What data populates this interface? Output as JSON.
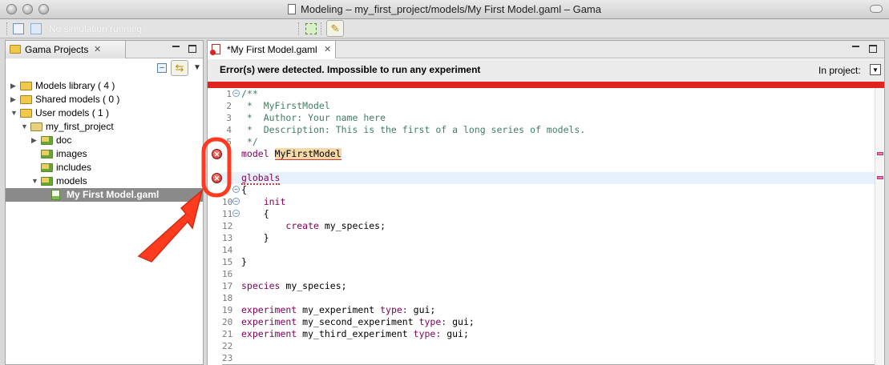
{
  "window": {
    "title": "Modeling – my_first_project/models/My First Model.gaml – Gama"
  },
  "toolbar": {
    "simulation_status": "No simulation running"
  },
  "projects_view": {
    "title": "Gama Projects",
    "close_glyph": "✕",
    "tree": [
      {
        "label": "Models library ( 4 )",
        "depth": 0,
        "expanded": false,
        "icon": "folder-icon"
      },
      {
        "label": "Shared models ( 0 )",
        "depth": 0,
        "expanded": false,
        "icon": "folder-icon"
      },
      {
        "label": "User models ( 1 )",
        "depth": 0,
        "expanded": true,
        "icon": "folder-icon"
      },
      {
        "label": "my_first_project",
        "depth": 1,
        "expanded": true,
        "icon": "project-icon"
      },
      {
        "label": "doc",
        "depth": 2,
        "expanded": false,
        "icon": "folder-icon"
      },
      {
        "label": "images",
        "depth": 2,
        "expanded": null,
        "icon": "folder-icon"
      },
      {
        "label": "includes",
        "depth": 2,
        "expanded": null,
        "icon": "folder-icon"
      },
      {
        "label": "models",
        "depth": 2,
        "expanded": true,
        "icon": "folder-icon"
      },
      {
        "label": "My First Model.gaml",
        "depth": 3,
        "expanded": null,
        "icon": "gaml-file-icon",
        "selected": true
      }
    ]
  },
  "editor": {
    "tab_label": "*My First Model.gaml",
    "close_glyph": "✕",
    "error_message": "Error(s) were detected. Impossible to run any experiment",
    "in_project_label": "In project:",
    "lines": [
      {
        "n": "1",
        "text": "/**",
        "fold": "⊖",
        "type": "comment"
      },
      {
        "n": "2",
        "text": " *  MyFirstModel",
        "type": "comment"
      },
      {
        "n": "3",
        "text": " *  Author: Your name here",
        "type": "comment"
      },
      {
        "n": "4",
        "text": " *  Description: This is the first of a long series of models.",
        "type": "comment"
      },
      {
        "n": "5",
        "text": " */",
        "type": "comment"
      },
      {
        "n": "",
        "text": "model ",
        "error_word": "MyFirstModel",
        "type": "model",
        "error": true
      },
      {
        "n": "",
        "text": "",
        "type": "blank"
      },
      {
        "n": "",
        "text": "globals",
        "type": "globals",
        "error": true,
        "highlight": true
      },
      {
        "n": "",
        "text": "{",
        "fold": "⊖",
        "type": "plain"
      },
      {
        "n": "10",
        "text": "    init",
        "fold": "⊖",
        "type": "kw"
      },
      {
        "n": "11",
        "text": "    {",
        "fold": "⊖",
        "type": "plain"
      },
      {
        "n": "12",
        "text": "        create my_species;",
        "type": "create"
      },
      {
        "n": "13",
        "text": "    }",
        "type": "plain"
      },
      {
        "n": "14",
        "text": "",
        "type": "blank"
      },
      {
        "n": "15",
        "text": "}",
        "type": "plain"
      },
      {
        "n": "16",
        "text": "",
        "type": "blank"
      },
      {
        "n": "17",
        "text": "species my_species;",
        "type": "species"
      },
      {
        "n": "18",
        "text": "",
        "type": "blank"
      },
      {
        "n": "19",
        "text": "experiment my_experiment type: gui;",
        "type": "experiment"
      },
      {
        "n": "20",
        "text": "experiment my_second_experiment type: gui;",
        "type": "experiment"
      },
      {
        "n": "21",
        "text": "experiment my_third_experiment type: gui;",
        "type": "experiment"
      },
      {
        "n": "22",
        "text": "",
        "type": "blank"
      },
      {
        "n": "23",
        "text": "",
        "type": "blank"
      }
    ]
  },
  "colors": {
    "error_bar": "#e0231d",
    "annotation": "#ff3b1f",
    "selection": "#8a8a8a"
  }
}
